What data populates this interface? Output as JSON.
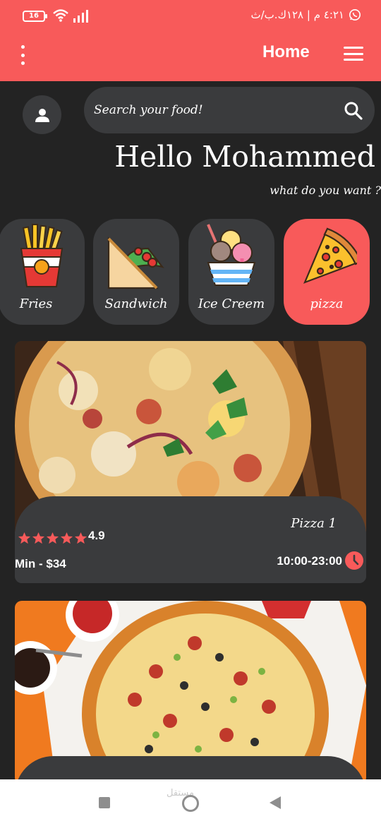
{
  "status_bar": {
    "battery": "16",
    "right_text": "٤:٢١ م | ١٢٨ك.ب/ث"
  },
  "app_bar": {
    "title": "Home"
  },
  "search": {
    "placeholder": "Search your food!"
  },
  "greeting": {
    "title": "Hello Mohammed",
    "subtitle": "what do you want ?"
  },
  "categories": [
    {
      "label": "Fries",
      "icon": "fries-icon",
      "selected": false
    },
    {
      "label": "Sandwich",
      "icon": "sandwich-icon",
      "selected": false
    },
    {
      "label": "Ice Creem",
      "icon": "ice-cream-icon",
      "selected": false
    },
    {
      "label": "pizza",
      "icon": "pizza-icon",
      "selected": true
    }
  ],
  "restaurants": [
    {
      "name": "Pizza 1",
      "rating": "4.9",
      "stars": 5,
      "min_price": "Min - $34",
      "hours": "10:00-23:00"
    }
  ],
  "nav": {
    "watermark": "مستقل"
  },
  "colors": {
    "accent": "#f85a5a",
    "background": "#232323",
    "surface": "#3a3b3d"
  }
}
